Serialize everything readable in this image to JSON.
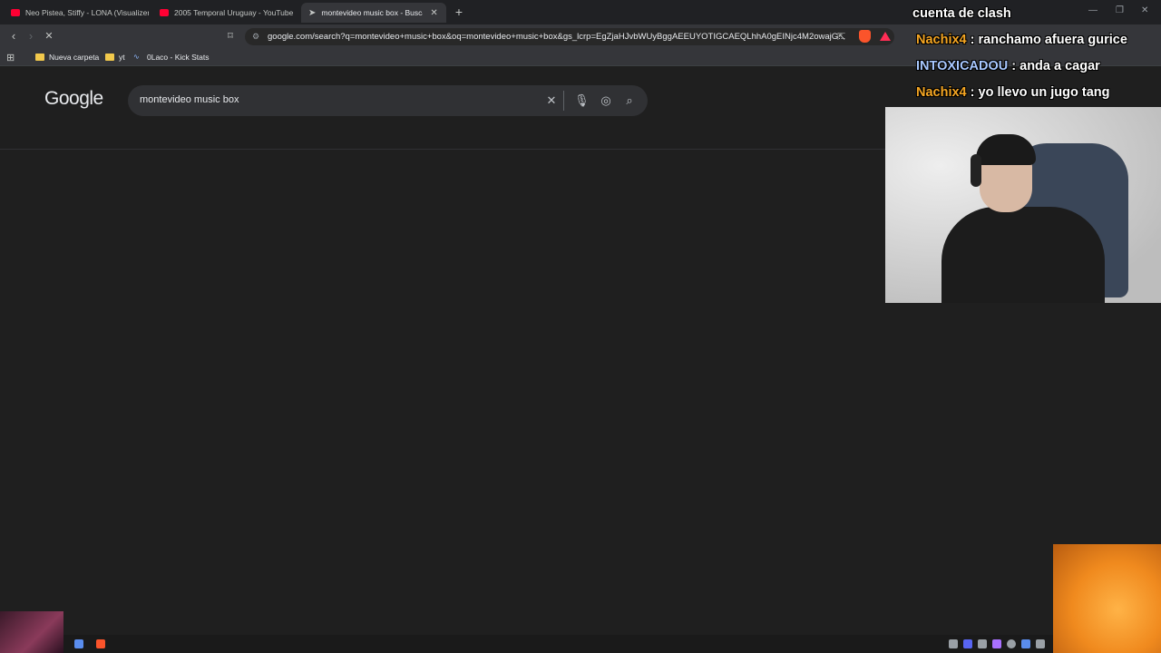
{
  "tabs": [
    {
      "title": "Neo Pistea, Stiffy - LONA (Visualizer)",
      "favicon": "youtube-icon"
    },
    {
      "title": "2005 Temporal Uruguay - YouTube",
      "favicon": "youtube-icon"
    },
    {
      "title": "montevideo music box - Buscar",
      "favicon": "cursor-icon",
      "active": true
    }
  ],
  "address": {
    "url": "google.com/search?q=montevideo+music+box&oq=montevideo+music+box&gs_lcrp=EgZjaHJvbWUyBggAEEUYOTIGCAEQLhhA0gEINjc4M2owajG..."
  },
  "bookmarks": [
    {
      "label": "Nueva carpeta",
      "icon": "folder-icon"
    },
    {
      "label": "yt",
      "icon": "folder-icon"
    },
    {
      "label": "0Laco - Kick Stats",
      "icon": "kick-icon"
    }
  ],
  "google": {
    "logo": "Google",
    "query": "montevideo music box"
  },
  "chat": {
    "title": "cuenta de clash",
    "messages": [
      {
        "user": "Nachix4",
        "sep": " : ",
        "text": "ranchamo afuera gurice"
      },
      {
        "user": "INTOXICADOU",
        "sep": " : ",
        "text": "anda a cagar"
      },
      {
        "user": "Nachix4",
        "sep": " : ",
        "text": "yo llevo un jugo tang"
      }
    ]
  },
  "colors": {
    "accent": "#8ab4f8",
    "youtube": "#ff0033",
    "chat_user": "#f5a623"
  }
}
